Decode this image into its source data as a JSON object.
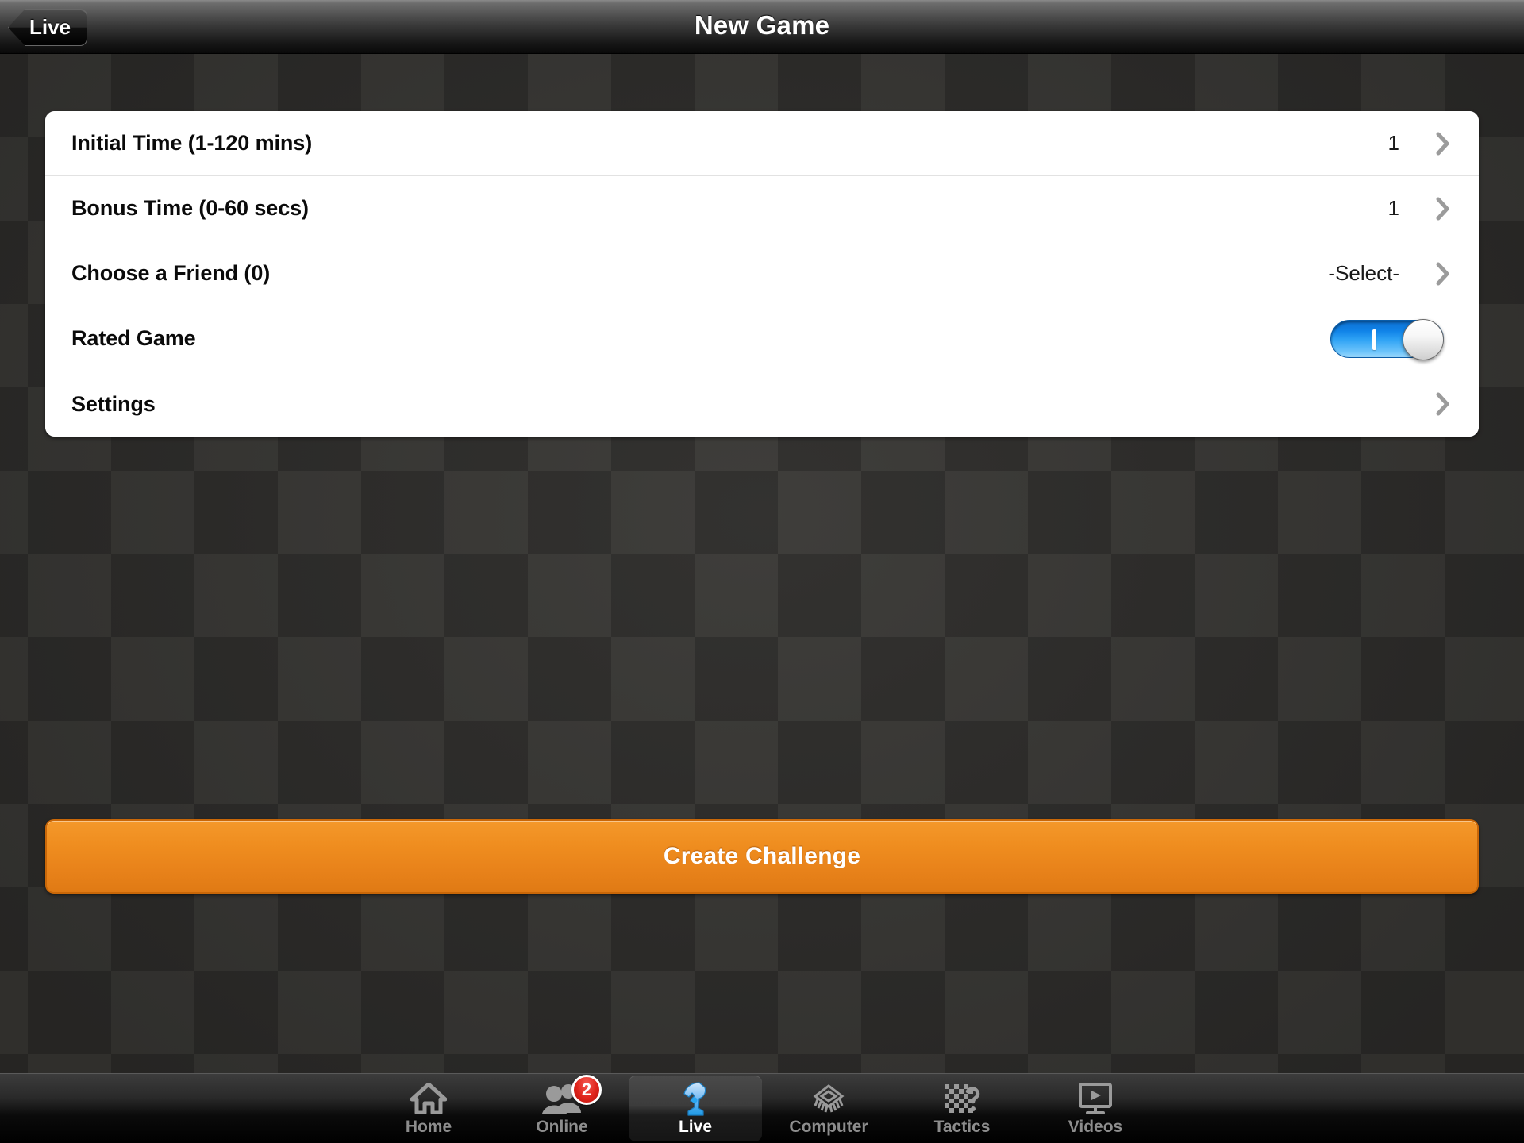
{
  "navbar": {
    "back_label": "Live",
    "title": "New Game"
  },
  "settings_rows": [
    {
      "label": "Initial Time (1-120 mins)",
      "value": "1",
      "control": "chevron",
      "name": "initial-time"
    },
    {
      "label": "Bonus Time (0-60 secs)",
      "value": "1",
      "control": "chevron",
      "name": "bonus-time"
    },
    {
      "label": "Choose a Friend (0)",
      "value": "-Select-",
      "control": "chevron",
      "name": "choose-friend"
    },
    {
      "label": "Rated Game",
      "value": "on",
      "control": "toggle",
      "name": "rated-game"
    },
    {
      "label": "Settings",
      "value": "",
      "control": "chevron",
      "name": "settings"
    }
  ],
  "cta": {
    "label": "Create Challenge"
  },
  "tabs": [
    {
      "label": "Home",
      "icon": "home-icon",
      "active": false,
      "badge": ""
    },
    {
      "label": "Online",
      "icon": "people-icon",
      "active": false,
      "badge": "2"
    },
    {
      "label": "Live",
      "icon": "knight-icon",
      "active": true,
      "badge": ""
    },
    {
      "label": "Computer",
      "icon": "chip-icon",
      "active": false,
      "badge": ""
    },
    {
      "label": "Tactics",
      "icon": "tactics-icon",
      "active": false,
      "badge": ""
    },
    {
      "label": "Videos",
      "icon": "video-icon",
      "active": false,
      "badge": ""
    }
  ],
  "colors": {
    "accent_orange": "#ef8d1f",
    "toggle_on_blue": "#1083e8",
    "badge_red": "#e0251c",
    "panel_bg": "#ffffff",
    "board_light": "#3a3936",
    "board_dark": "#2e2d2b"
  }
}
